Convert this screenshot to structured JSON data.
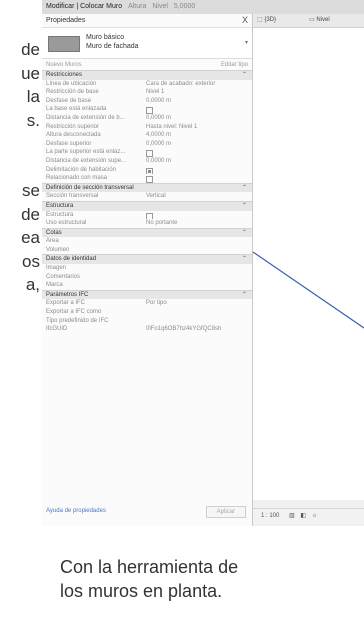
{
  "side_text": {
    "lines_top": [
      "de",
      "ue",
      "la",
      "s."
    ],
    "lines_bottom": [
      "se",
      "de",
      "ea",
      "os",
      "a,"
    ]
  },
  "caption": {
    "line1": "Con la herramienta de",
    "line2": "los muros en planta."
  },
  "ribbon": {
    "context": "Modificar | Colocar Muro",
    "field1": "Altura",
    "field2": "Nivel",
    "value": "5,0000"
  },
  "palette": {
    "title": "Propiedades",
    "close": "X",
    "type_line1": "Muro básico",
    "type_line2": "Muro de fachada",
    "filter": "Nuevo Muros",
    "edit_type": "Editar tipo",
    "footer_help": "Ayuda de propiedades",
    "apply": "Aplicar"
  },
  "properties": [
    {
      "kind": "cat",
      "label": "Restricciones"
    },
    {
      "kind": "row",
      "key": "Línea de ubicación",
      "value": "Cara de acabado: exterior"
    },
    {
      "kind": "row",
      "key": "Restricción de base",
      "value": "Nivel 1"
    },
    {
      "kind": "row",
      "key": "Desfase de base",
      "value": "0,0000 m"
    },
    {
      "kind": "row",
      "key": "La base está enlazada",
      "check": false
    },
    {
      "kind": "row",
      "key": "Distancia de extensión de b...",
      "value": "0,0000 m"
    },
    {
      "kind": "row",
      "key": "Restricción superior",
      "value": "Hasta nivel: Nivel 1"
    },
    {
      "kind": "row",
      "key": "Altura desconectada",
      "value": "4,0000 m"
    },
    {
      "kind": "row",
      "key": "Desfase superior",
      "value": "0,0000 m"
    },
    {
      "kind": "row",
      "key": "La parte superior está enlaz...",
      "check": false
    },
    {
      "kind": "row",
      "key": "Distancia de extensión supe...",
      "value": "0,0000 m"
    },
    {
      "kind": "row",
      "key": "Delimitación de habitación",
      "check": true
    },
    {
      "kind": "row",
      "key": "Relacionado con masa",
      "check": false
    },
    {
      "kind": "cat",
      "label": "Definición de sección transversal"
    },
    {
      "kind": "row",
      "key": "Sección transversal",
      "value": "Vertical"
    },
    {
      "kind": "cat",
      "label": "Estructura"
    },
    {
      "kind": "row",
      "key": "Estructura",
      "check": false
    },
    {
      "kind": "row",
      "key": "Uso estructural",
      "value": "No portante"
    },
    {
      "kind": "cat",
      "label": "Cotas"
    },
    {
      "kind": "row",
      "key": "Área",
      "value": ""
    },
    {
      "kind": "row",
      "key": "Volumen",
      "value": ""
    },
    {
      "kind": "cat",
      "label": "Datos de identidad"
    },
    {
      "kind": "row",
      "key": "Imagen",
      "value": ""
    },
    {
      "kind": "row",
      "key": "Comentarios",
      "value": ""
    },
    {
      "kind": "row",
      "key": "Marca",
      "value": ""
    },
    {
      "kind": "cat",
      "label": "Parámetros IFC"
    },
    {
      "kind": "row",
      "key": "Exportar a IFC",
      "value": "Por tipo"
    },
    {
      "kind": "row",
      "key": "Exportar a IFC como",
      "value": ""
    },
    {
      "kind": "row",
      "key": "Tipo predefinido de IFC",
      "value": ""
    },
    {
      "kind": "row",
      "key": "IfcGUID",
      "value": "0lFo1q6OB7hz4kYGfQC8sh"
    }
  ],
  "view_tabs": {
    "tab1": "{3D}",
    "tab2": "Nivel"
  },
  "status": {
    "scale": "1 : 100"
  },
  "colors": {
    "wall_sketch": "#3a5fb0",
    "link": "#4a78c4"
  }
}
